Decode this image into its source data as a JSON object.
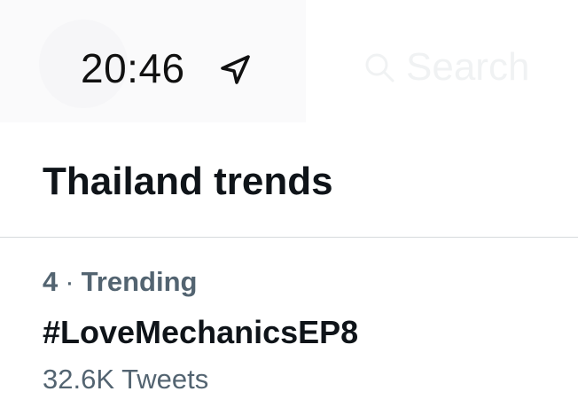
{
  "status_bar": {
    "time": "20:46",
    "location_icon": "location-arrow-icon"
  },
  "search": {
    "placeholder": "Search"
  },
  "section": {
    "title": "Thailand trends"
  },
  "trends": [
    {
      "rank": "4",
      "separator": "·",
      "category": "Trending",
      "name": "#LoveMechanicsEP8",
      "tweet_count": "32.6K Tweets"
    }
  ],
  "colors": {
    "primary_text": "#0f1419",
    "secondary_text": "#536471",
    "divider": "#d6dadd",
    "background": "#ffffff"
  }
}
